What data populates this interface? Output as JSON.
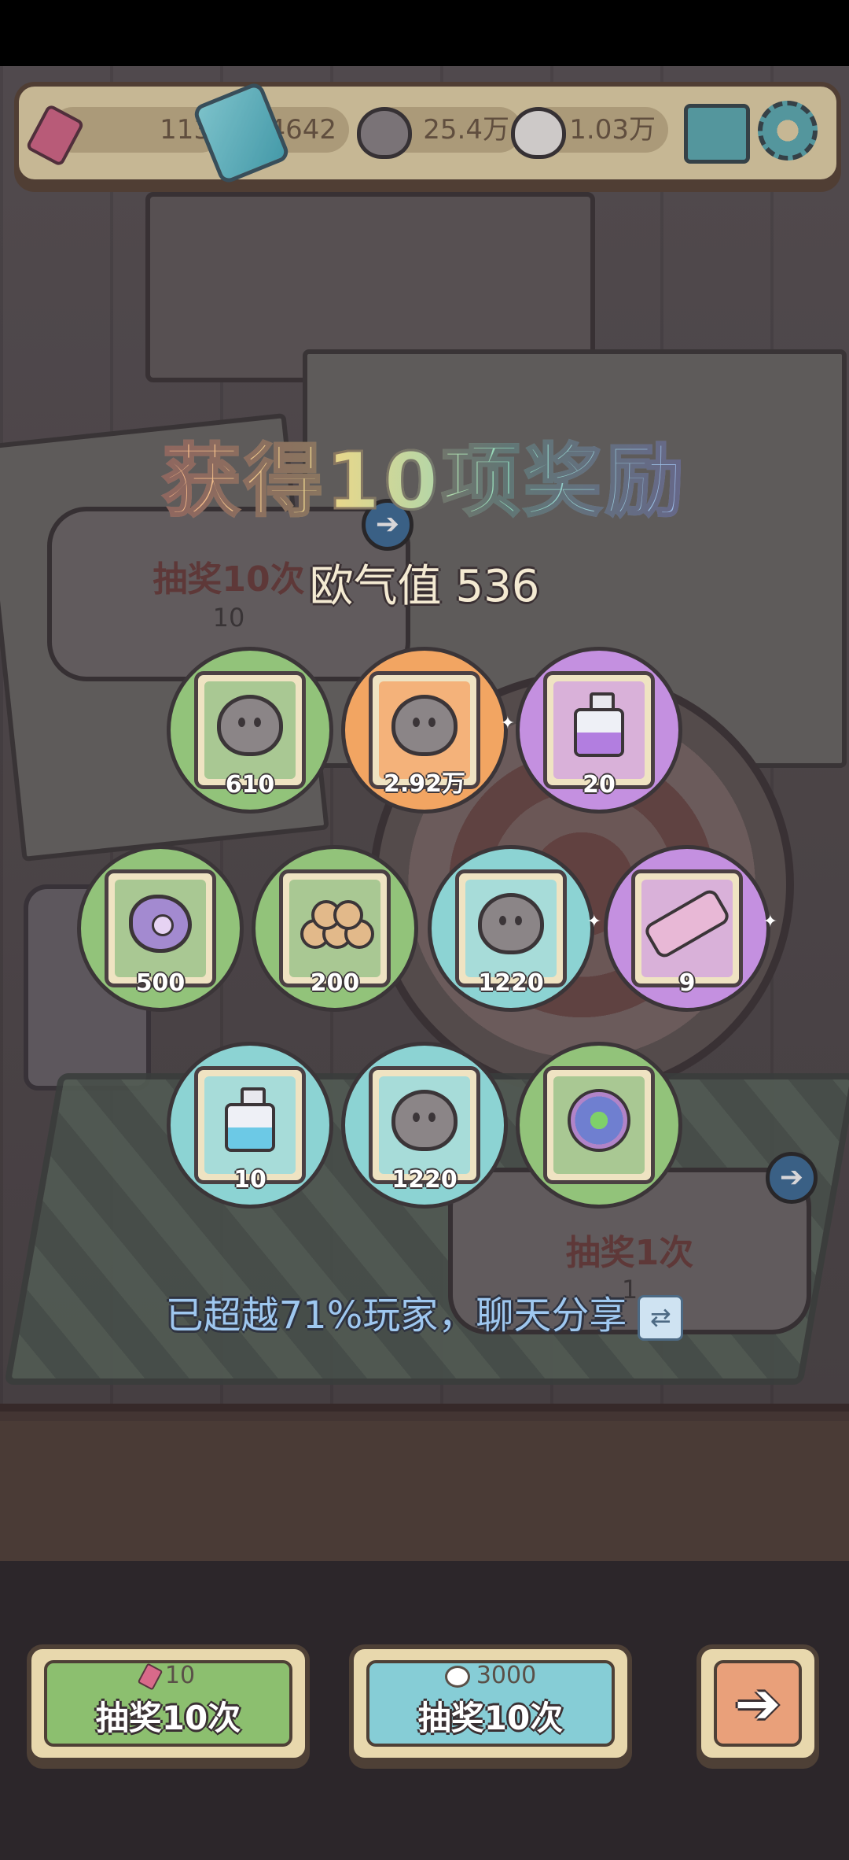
{
  "topbar": {
    "tickets": "113",
    "crystals": "4642",
    "gray_souls": "25.4万",
    "white_souls": "1.03万",
    "icons": [
      "ticket-icon",
      "crystal-icon",
      "gray-soul-icon",
      "white-soul-icon",
      "mail-icon",
      "gear-icon"
    ]
  },
  "background": {
    "ten_draw_label": "抽奖10次",
    "ten_draw_cost": "10",
    "one_draw_label": "抽奖1次",
    "one_draw_cost": "1"
  },
  "reward": {
    "title": "获得10项奖励",
    "luck_label": "欧气值 536",
    "items": [
      {
        "qty": "610",
        "art": "gray-soul",
        "rarity": "green"
      },
      {
        "qty": "2.92万",
        "art": "gray-soul",
        "rarity": "orange"
      },
      {
        "qty": "20",
        "art": "purple-potion",
        "rarity": "purple"
      },
      {
        "qty": "500",
        "art": "germ",
        "rarity": "green"
      },
      {
        "qty": "200",
        "art": "wood-logs",
        "rarity": "green"
      },
      {
        "qty": "1220",
        "art": "gray-soul",
        "rarity": "teal"
      },
      {
        "qty": "9",
        "art": "scope",
        "rarity": "purple"
      },
      {
        "qty": "10",
        "art": "blue-potion",
        "rarity": "teal"
      },
      {
        "qty": "1220",
        "art": "gray-soul",
        "rarity": "teal"
      },
      {
        "qty": "",
        "art": "flower-ring",
        "rarity": "green"
      }
    ],
    "share_text": "已超越71%玩家，聊天分享"
  },
  "bottom": {
    "left_cost": "10",
    "left_label": "抽奖10次",
    "middle_cost": "3000",
    "middle_label": "抽奖10次",
    "next_icon": "arrow-right-icon"
  },
  "colors": {
    "green": "#92c37a",
    "orange": "#f2a562",
    "purple": "#c490e0",
    "teal": "#8cd3d3"
  }
}
